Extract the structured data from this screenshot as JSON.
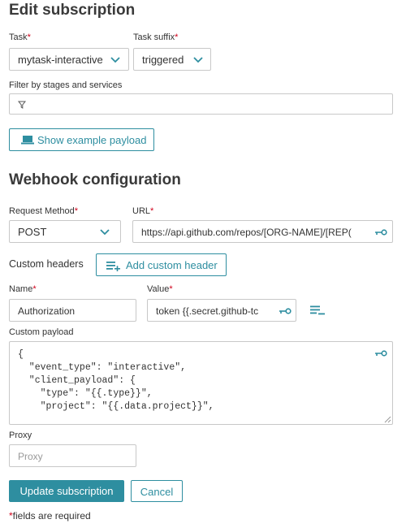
{
  "title": "Edit subscription",
  "task": {
    "label": "Task",
    "value": "mytask-interactive"
  },
  "task_suffix": {
    "label": "Task suffix",
    "value": "triggered"
  },
  "filter": {
    "label": "Filter by stages and services",
    "placeholder": ""
  },
  "example_payload_label": "Show example payload",
  "webhook_title": "Webhook configuration",
  "request_method": {
    "label": "Request Method",
    "value": "POST"
  },
  "url": {
    "label": "URL",
    "value": "https://api.github.com/repos/[ORG-NAME]/[REP("
  },
  "custom_headers": {
    "label": "Custom headers",
    "add_label": "Add custom header"
  },
  "header_name": {
    "label": "Name",
    "value": "Authorization"
  },
  "header_value": {
    "label": "Value",
    "value": "token {{.secret.github-tc"
  },
  "custom_payload": {
    "label": "Custom payload",
    "lines": [
      "{",
      "  \"event_type\": \"interactive\",",
      "  \"client_payload\": {",
      "    \"type\": \"{{.type}}\",",
      "    \"project\": \"{{.data.project}}\","
    ]
  },
  "proxy": {
    "label": "Proxy",
    "placeholder": "Proxy"
  },
  "actions": {
    "update_label": "Update subscription",
    "cancel_label": "Cancel"
  },
  "required_note": {
    "star": "*",
    "text": "fields are required"
  },
  "required_mark": "*",
  "colors": {
    "accent": "#2e8ea0",
    "required": "#d0021b",
    "border": "#c8c8c8"
  }
}
